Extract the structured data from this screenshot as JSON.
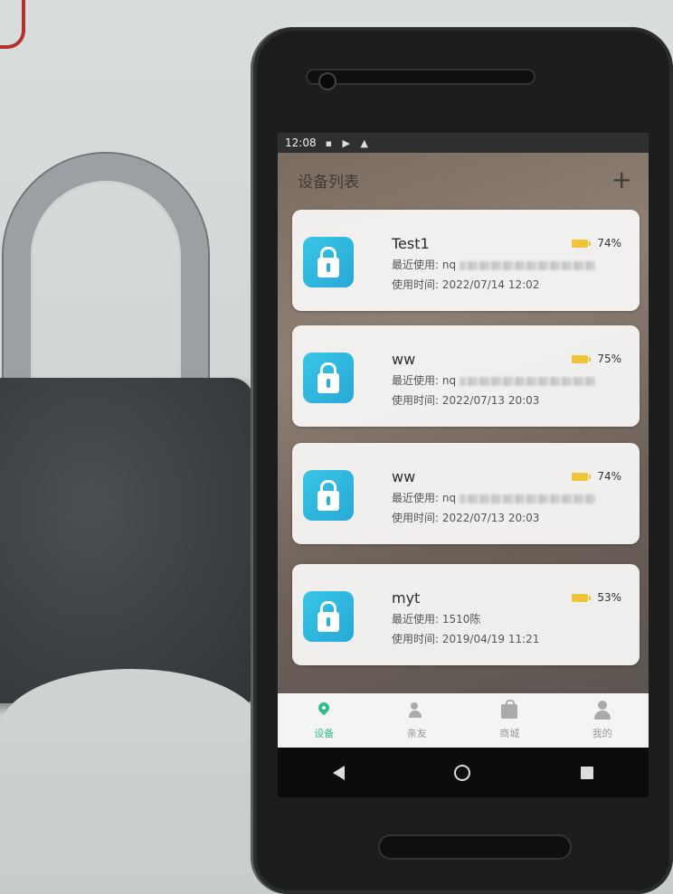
{
  "status_bar": {
    "time": "12:08",
    "icons": "▪ ▶ ▲"
  },
  "header": {
    "title": "设备列表",
    "add_icon": "+"
  },
  "devices": [
    {
      "name": "Test1",
      "battery": "74%",
      "battery_level": 0.74,
      "last_user_label": "最近使用:",
      "last_user_value": "nq",
      "time_label": "使用时间:",
      "time_value": "2022/07/14 12:02"
    },
    {
      "name": "ww",
      "battery": "75%",
      "battery_level": 0.75,
      "last_user_label": "最近使用:",
      "last_user_value": "nq",
      "time_label": "使用时间:",
      "time_value": "2022/07/13 20:03"
    },
    {
      "name": "ww",
      "battery": "74%",
      "battery_level": 0.74,
      "last_user_label": "最近使用:",
      "last_user_value": "nq",
      "time_label": "使用时间:",
      "time_value": "2022/07/13 20:03"
    },
    {
      "name": "myt",
      "battery": "53%",
      "battery_level": 0.53,
      "last_user_label": "最近使用:",
      "last_user_value": "1510陈",
      "time_label": "使用时间:",
      "time_value": "2019/04/19 11:21"
    }
  ],
  "tabs": [
    {
      "label": "设备",
      "icon": "location-pin-icon",
      "active": true
    },
    {
      "label": "亲友",
      "icon": "people-icon",
      "active": false
    },
    {
      "label": "商城",
      "icon": "shopping-bag-icon",
      "active": false
    },
    {
      "label": "我的",
      "icon": "person-icon",
      "active": false
    }
  ],
  "colors": {
    "accent": "#2fbd8f",
    "lock_icon": "#2aaed9",
    "battery": "#f0c43a"
  }
}
